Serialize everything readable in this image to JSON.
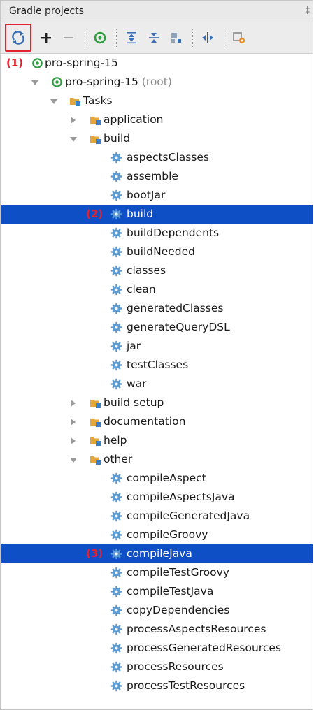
{
  "panel": {
    "title": "Gradle projects",
    "pin_glyph": "‡"
  },
  "toolbar": {
    "buttons": [
      {
        "name": "refresh-all-icon",
        "highlight": true
      },
      {
        "name": "add-icon"
      },
      {
        "name": "remove-icon"
      },
      {
        "name": "execute-task-icon"
      },
      {
        "name": "expand-all-icon"
      },
      {
        "name": "collapse-all-icon"
      },
      {
        "name": "offline-mode-icon"
      },
      {
        "name": "toggle-dependencies-icon"
      },
      {
        "name": "settings-icon"
      }
    ]
  },
  "callouts": {
    "c1": "(1)",
    "c2": "(2)",
    "c3": "(3)"
  },
  "tree": {
    "project": "pro-spring-15",
    "root_module": "pro-spring-15",
    "root_suffix": "(root)",
    "tasks": "Tasks",
    "groups": {
      "application": "application",
      "build": "build",
      "build_setup": "build setup",
      "documentation": "documentation",
      "help": "help",
      "other": "other"
    },
    "build_tasks": [
      "aspectsClasses",
      "assemble",
      "bootJar",
      "build",
      "buildDependents",
      "buildNeeded",
      "classes",
      "clean",
      "generatedClasses",
      "generateQueryDSL",
      "jar",
      "testClasses",
      "war"
    ],
    "other_tasks": [
      "compileAspect",
      "compileAspectsJava",
      "compileGeneratedJava",
      "compileGroovy",
      "compileJava",
      "compileTestGroovy",
      "compileTestJava",
      "copyDependencies",
      "processAspectsResources",
      "processGeneratedResources",
      "processResources",
      "processTestResources"
    ]
  },
  "colors": {
    "selection": "#0f4fc6",
    "callout": "#e0232e",
    "gradle_green": "#2e9e3f"
  }
}
